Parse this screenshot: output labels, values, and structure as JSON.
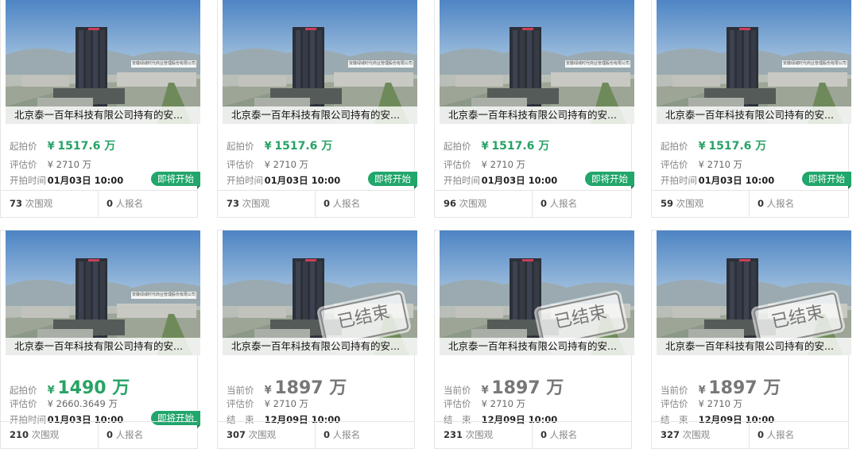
{
  "colors": {
    "accent": "#21a66b",
    "price_green": "#27a265",
    "price_gray": "#777777"
  },
  "cards": [
    {
      "title": "北京泰一百年科技有限公司持有的安...",
      "photo_caption": "安徽绿城时代商业管理股份有限公司",
      "price_label": "起拍价",
      "price_yen": "¥",
      "price": "1517.6 万",
      "estimate_label": "评估价",
      "estimate": "¥ 2710 万",
      "time_label": "开拍时间",
      "time": "01月03日 10:00",
      "badge": "即将开始",
      "ended_stamp": "",
      "views": "73",
      "views_label": "次围观",
      "signups": "0",
      "signups_label": "人报名"
    },
    {
      "title": "北京泰一百年科技有限公司持有的安...",
      "photo_caption": "安徽绿城时代商业管理股份有限公司",
      "price_label": "起拍价",
      "price_yen": "¥",
      "price": "1517.6 万",
      "estimate_label": "评估价",
      "estimate": "¥ 2710 万",
      "time_label": "开拍时间",
      "time": "01月03日 10:00",
      "badge": "即将开始",
      "ended_stamp": "",
      "views": "73",
      "views_label": "次围观",
      "signups": "0",
      "signups_label": "人报名"
    },
    {
      "title": "北京泰一百年科技有限公司持有的安...",
      "photo_caption": "安徽绿城时代商业管理股份有限公司",
      "price_label": "起拍价",
      "price_yen": "¥",
      "price": "1517.6 万",
      "estimate_label": "评估价",
      "estimate": "¥ 2710 万",
      "time_label": "开拍时间",
      "time": "01月03日 10:00",
      "badge": "即将开始",
      "ended_stamp": "",
      "views": "96",
      "views_label": "次围观",
      "signups": "0",
      "signups_label": "人报名"
    },
    {
      "title": "北京泰一百年科技有限公司持有的安...",
      "photo_caption": "安徽绿城时代商业管理股份有限公司",
      "price_label": "起拍价",
      "price_yen": "¥",
      "price": "1517.6 万",
      "estimate_label": "评估价",
      "estimate": "¥ 2710 万",
      "time_label": "开拍时间",
      "time": "01月03日 10:00",
      "badge": "即将开始",
      "ended_stamp": "",
      "views": "59",
      "views_label": "次围观",
      "signups": "0",
      "signups_label": "人报名"
    },
    {
      "title": "北京泰一百年科技有限公司持有的安...",
      "photo_caption": "安徽绿城时代商业管理股份有限公司",
      "price_label": "起拍价",
      "price_yen": "¥",
      "price": "1490 万",
      "estimate_label": "评估价",
      "estimate": "¥ 2660.3649 万",
      "time_label": "开拍时间",
      "time": "01月03日 10:00",
      "badge": "即将开始",
      "ended_stamp": "",
      "views": "210",
      "views_label": "次围观",
      "signups": "0",
      "signups_label": "人报名"
    },
    {
      "title": "北京泰一百年科技有限公司持有的安...",
      "photo_caption": "",
      "price_label": "当前价",
      "price_yen": "¥",
      "price": "1897 万",
      "estimate_label": "评估价",
      "estimate": "¥ 2710 万",
      "time_label": "结　束",
      "time": "12月09日 10:00",
      "badge": "",
      "ended_stamp": "已结束",
      "views": "307",
      "views_label": "次围观",
      "signups": "0",
      "signups_label": "人报名"
    },
    {
      "title": "北京泰一百年科技有限公司持有的安...",
      "photo_caption": "",
      "price_label": "当前价",
      "price_yen": "¥",
      "price": "1897 万",
      "estimate_label": "评估价",
      "estimate": "¥ 2710 万",
      "time_label": "结　束",
      "time": "12月09日 10:00",
      "badge": "",
      "ended_stamp": "已结束",
      "views": "231",
      "views_label": "次围观",
      "signups": "0",
      "signups_label": "人报名"
    },
    {
      "title": "北京泰一百年科技有限公司持有的安...",
      "photo_caption": "",
      "price_label": "当前价",
      "price_yen": "¥",
      "price": "1897 万",
      "estimate_label": "评估价",
      "estimate": "¥ 2710 万",
      "time_label": "结　束",
      "time": "12月09日 10:00",
      "badge": "",
      "ended_stamp": "已结束",
      "views": "327",
      "views_label": "次围观",
      "signups": "0",
      "signups_label": "人报名"
    }
  ]
}
